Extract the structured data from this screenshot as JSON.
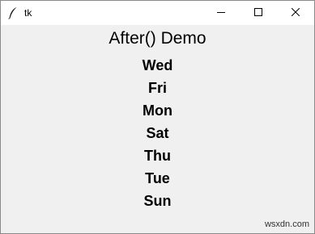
{
  "window": {
    "title": "tk"
  },
  "content": {
    "heading": "After() Demo",
    "days": [
      "Wed",
      "Fri",
      "Mon",
      "Sat",
      "Thu",
      "Tue",
      "Sun"
    ]
  },
  "watermark": "wsxdn.com",
  "icons": {
    "app": "feather-icon",
    "minimize": "minimize-icon",
    "maximize": "maximize-icon",
    "close": "close-icon"
  }
}
